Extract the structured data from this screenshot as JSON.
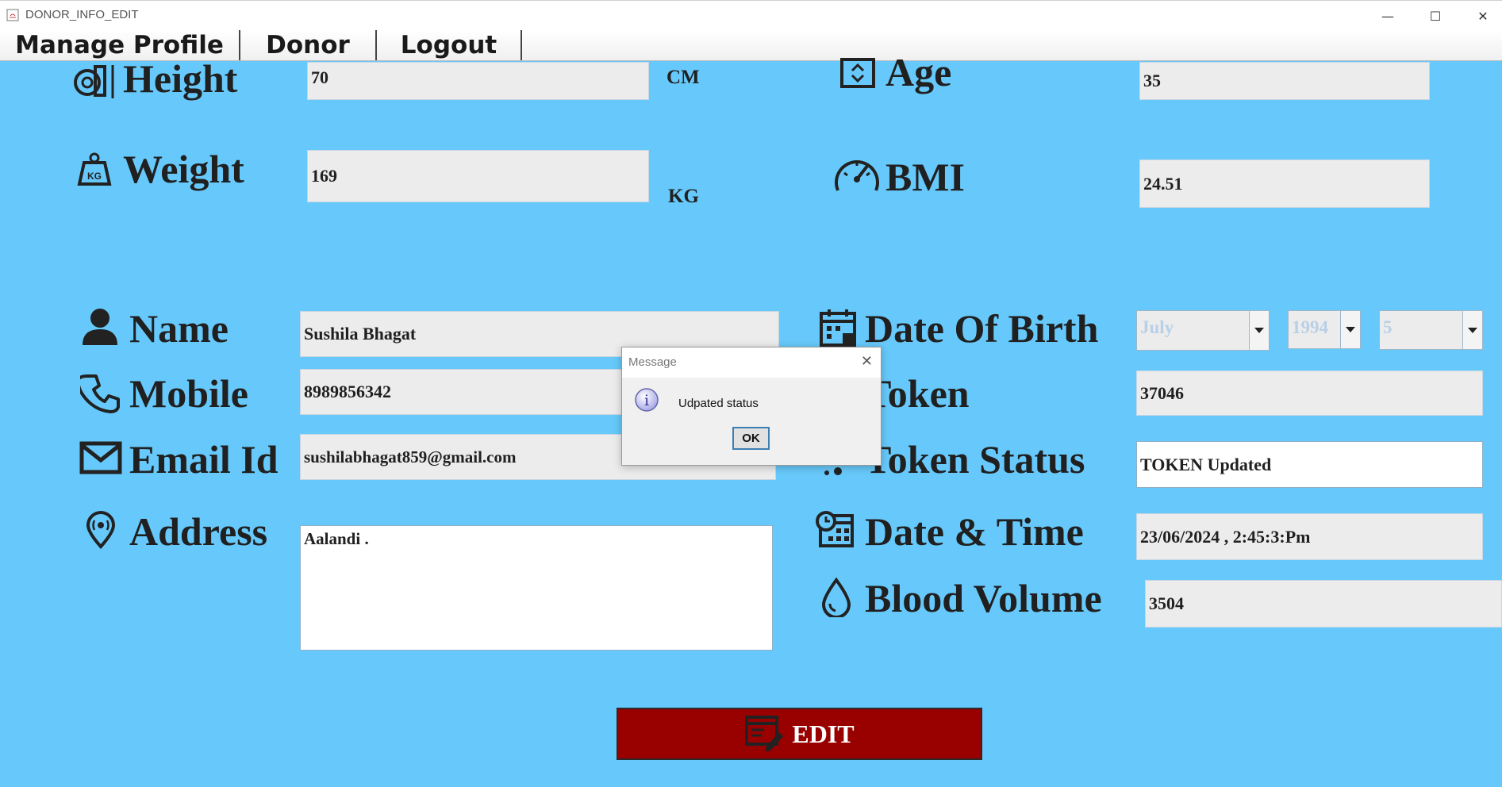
{
  "window": {
    "title": "DONOR_INFO_EDIT",
    "minimize": "—",
    "maximize": "☐",
    "close": "✕"
  },
  "menu": [
    "Manage Profile",
    "Donor",
    "Logout"
  ],
  "fields": {
    "height": {
      "label": "Height",
      "value": "70",
      "unit": "CM"
    },
    "weight": {
      "label": "Weight",
      "value": "169",
      "unit": "KG"
    },
    "age": {
      "label": "Age",
      "value": "35"
    },
    "bmi": {
      "label": "BMI",
      "value": "24.51"
    },
    "name": {
      "label": "Name",
      "value": "Sushila Bhagat"
    },
    "mobile": {
      "label": "Mobile",
      "value": "8989856342"
    },
    "email": {
      "label": "Email Id",
      "value": "sushilabhagat859@gmail.com"
    },
    "address": {
      "label": "Address",
      "value": "Aalandi ."
    },
    "dob": {
      "label": "Date Of Birth",
      "month": "July",
      "year": "1994",
      "day": "5"
    },
    "token": {
      "label": "Token",
      "value": "37046"
    },
    "token_status": {
      "label": "Token Status",
      "value": "TOKEN Updated"
    },
    "datetime": {
      "label": "Date & Time",
      "value": "23/06/2024 , 2:45:3:Pm"
    },
    "blood_volume": {
      "label": "Blood Volume",
      "value": "3504"
    }
  },
  "dialog": {
    "title": "Message",
    "message": "Udpated status",
    "ok": "OK",
    "close": "✕",
    "info_glyph": "i"
  },
  "edit_button": {
    "label": "EDIT"
  },
  "colors": {
    "background": "#67c9fb",
    "edit_button": "#990000",
    "field": "#ececec"
  }
}
